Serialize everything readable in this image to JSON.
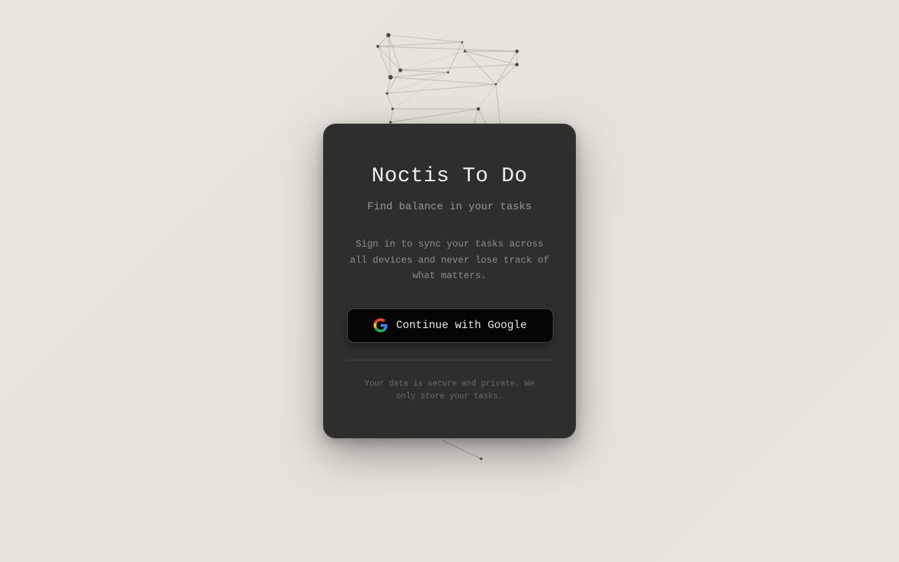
{
  "app": {
    "title": "Noctis To Do",
    "subtitle": "Find balance in your tasks"
  },
  "signin": {
    "description": "Sign in to sync your tasks across all devices and never lose track of what matters.",
    "google_button_label": "Continue with Google",
    "google_icon": "google-g-icon",
    "footnote": "Your data is secure and private. We only store your tasks."
  },
  "theme": {
    "background": "#e8e5df",
    "card": "#2e2e2d",
    "button": "#050505",
    "google_blue": "#4285F4",
    "google_red": "#EA4335",
    "google_yellow": "#FBBC05",
    "google_green": "#34A853"
  }
}
